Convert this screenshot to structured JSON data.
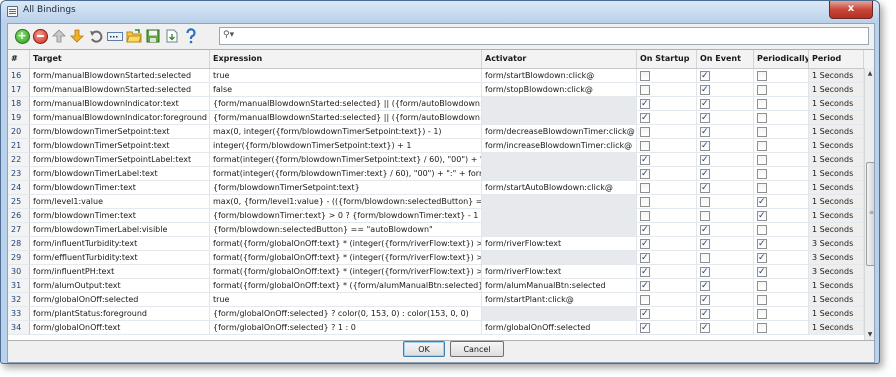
{
  "window": {
    "title": "All Bindings",
    "close_label": "x"
  },
  "toolbar": {
    "buttons": [
      {
        "name": "add-binding-button",
        "icon": "plus-circle-icon",
        "glyph": "+"
      },
      {
        "name": "remove-binding-button",
        "icon": "minus-circle-icon",
        "glyph": ""
      },
      {
        "name": "move-up-button",
        "icon": "arrow-up-icon",
        "glyph": "↑"
      },
      {
        "name": "move-down-button",
        "icon": "arrow-down-icon",
        "glyph": "↓"
      },
      {
        "name": "undo-button",
        "icon": "undo-icon",
        "glyph": "↶"
      },
      {
        "name": "rename-button",
        "icon": "text-field-icon",
        "glyph": "…"
      },
      {
        "name": "open-button",
        "icon": "folder-icon",
        "glyph": "▤"
      },
      {
        "name": "save-button",
        "icon": "save-disk-icon",
        "glyph": "▣"
      },
      {
        "name": "export-button",
        "icon": "document-arrow-icon",
        "glyph": "⇩"
      },
      {
        "name": "help-button",
        "icon": "help-icon",
        "glyph": "?"
      }
    ],
    "search_placeholder": ""
  },
  "table": {
    "columns": [
      "#",
      "Target",
      "Expression",
      "Activator",
      "On Startup",
      "On Event",
      "Periodically",
      "Period"
    ],
    "rows": [
      {
        "num": "16",
        "target": "form/manualBlowdownStarted:selected",
        "expr": "true",
        "act": "form/startBlowdown:click@",
        "s": false,
        "e": true,
        "p": false,
        "period": "1 Seconds"
      },
      {
        "num": "17",
        "target": "form/manualBlowdownStarted:selected",
        "expr": "false",
        "act": "form/stopBlowdown:click@",
        "s": false,
        "e": true,
        "p": false,
        "period": "1 Seconds"
      },
      {
        "num": "18",
        "target": "form/manualBlowdownIndicator:text",
        "expr": "{form/manualBlowdownStarted:selected} || ({form/autoBlowdown:sel...",
        "act": "",
        "s": true,
        "e": true,
        "p": false,
        "period": "1 Seconds"
      },
      {
        "num": "19",
        "target": "form/manualBlowdownIndicator:foreground",
        "expr": "{form/manualBlowdownStarted:selected} || ({form/autoBlowdown:sel...",
        "act": "",
        "s": true,
        "e": true,
        "p": false,
        "period": "1 Seconds"
      },
      {
        "num": "20",
        "target": "form/blowdownTimerSetpoint:text",
        "expr": "max(0, integer({form/blowdownTimerSetpoint:text}) - 1)",
        "act": "form/decreaseBlowdownTimer:click@",
        "s": false,
        "e": true,
        "p": false,
        "period": "1 Seconds"
      },
      {
        "num": "21",
        "target": "form/blowdownTimerSetpoint:text",
        "expr": "integer({form/blowdownTimerSetpoint:text}) + 1",
        "act": "form/increaseBlowdownTimer:click@",
        "s": false,
        "e": true,
        "p": false,
        "period": "1 Seconds"
      },
      {
        "num": "22",
        "target": "form/blowdownTimerSetpointLabel:text",
        "expr": "format(integer({form/blowdownTimerSetpoint:text} / 60), \"00\") + \":\" ...",
        "act": "",
        "s": true,
        "e": true,
        "p": false,
        "period": "1 Seconds"
      },
      {
        "num": "23",
        "target": "form/blowdownTimerLabel:text",
        "expr": "format(integer({form/blowdownTimer:text} / 60), \"00\") + \":\" + format...",
        "act": "",
        "s": true,
        "e": true,
        "p": false,
        "period": "1 Seconds"
      },
      {
        "num": "24",
        "target": "form/blowdownTimer:text",
        "expr": "{form/blowdownTimerSetpoint:text}",
        "act": "form/startAutoBlowdown:click@",
        "s": false,
        "e": true,
        "p": false,
        "period": "1 Seconds"
      },
      {
        "num": "25",
        "target": "form/level1:value",
        "expr": "max(0, {form/level1:value} - (({form/blowdown:selectedButton} == \"...",
        "act": "",
        "s": false,
        "e": false,
        "p": true,
        "period": "1 Seconds"
      },
      {
        "num": "26",
        "target": "form/blowdownTimer:text",
        "expr": "{form/blowdownTimer:text} > 0 ? {form/blowdownTimer:text} - 1 : {fo...",
        "act": "",
        "s": false,
        "e": false,
        "p": true,
        "period": "1 Seconds"
      },
      {
        "num": "27",
        "target": "form/blowdownTimerLabel:visible",
        "expr": "{form/blowdown:selectedButton} == \"autoBlowdown\"",
        "act": "",
        "s": true,
        "e": true,
        "p": false,
        "period": "1 Seconds"
      },
      {
        "num": "28",
        "target": "form/influentTurbidity:text",
        "expr": "format({form/globalOnOff:text} * (integer({form/riverFlow:text}) > 0...",
        "act": "form/riverFlow:text",
        "s": true,
        "e": true,
        "p": true,
        "period": "3 Seconds"
      },
      {
        "num": "29",
        "target": "form/effluentTurbidity:text",
        "expr": "format({form/globalOnOff:text} * (integer({form/riverFlow:text}) > 0...",
        "act": "",
        "s": true,
        "e": false,
        "p": true,
        "period": "3 Seconds"
      },
      {
        "num": "30",
        "target": "form/influentPH:text",
        "expr": "format({form/globalOnOff:text} * (integer({form/riverFlow:text}) > 0...",
        "act": "form/riverFlow:text",
        "s": true,
        "e": true,
        "p": true,
        "period": "3 Seconds"
      },
      {
        "num": "31",
        "target": "form/alumOutput:text",
        "expr": "format({form/globalOnOff:text} * ({form/alumManualBtn:selected} ? ...",
        "act": "form/alumManualBtn:selected",
        "s": true,
        "e": true,
        "p": false,
        "period": "1 Seconds"
      },
      {
        "num": "32",
        "target": "form/globalOnOff:selected",
        "expr": "true",
        "act": "form/startPlant:click@",
        "s": false,
        "e": true,
        "p": false,
        "period": "1 Seconds"
      },
      {
        "num": "33",
        "target": "form/plantStatus:foreground",
        "expr": "{form/globalOnOff:selected} ? color(0, 153, 0) : color(153, 0, 0)",
        "act": "",
        "s": true,
        "e": true,
        "p": false,
        "period": "1 Seconds"
      },
      {
        "num": "34",
        "target": "form/globalOnOff:text",
        "expr": "{form/globalOnOff:selected} ? 1 : 0",
        "act": "form/globalOnOff:selected",
        "s": true,
        "e": true,
        "p": false,
        "period": "1 Seconds"
      }
    ]
  },
  "footer": {
    "ok_label": "OK",
    "cancel_label": "Cancel"
  },
  "colors": {
    "activator_gray": "#e8e9ec",
    "title_bg": "#c4d7ee",
    "accent": "#1e3f7a"
  }
}
